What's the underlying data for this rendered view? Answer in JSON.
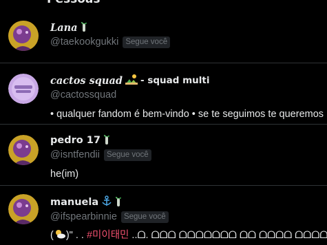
{
  "header": {
    "title": "Pessoas"
  },
  "colors": {
    "background": "#000000",
    "divider": "#2f3336",
    "primary_text": "#e7e9ea",
    "secondary_text": "#71767b",
    "badge_bg": "#202327"
  },
  "users": [
    {
      "name": "Lana",
      "name_icons": [
        "seedling-icon"
      ],
      "handle": "@taekookgukki",
      "follows_you": "Segue você",
      "bio": ""
    },
    {
      "name": "cactos squad",
      "name_suffix": " - squad multi",
      "name_icons": [
        "desert-icon"
      ],
      "handle": "@cactossquad",
      "follows_you": "",
      "bio": "• qualquer fandom é bem-vindo • se te seguimos te queremos"
    },
    {
      "name": "pedro 17",
      "name_icons": [
        "seedling-icon"
      ],
      "handle": "@isntfendii",
      "follows_you": "Segue você",
      "bio": "he(im)"
    },
    {
      "name": "manuela",
      "name_icons": [
        "anchor-icon",
        "seedling-icon"
      ],
      "handle": "@ifspearbinnie",
      "follows_you": "Segue você",
      "bio_prefix": "(",
      "bio_suffix": ")\" . . ",
      "bio_hashtag": "#미이태민",
      "bio_rest": " ..ᗝ. ᗝᗝᗝ ᗝᗝᗝᗝᗝᗝᗝ ᗝᗝ ᗝᗝᗝᗝ ᗝᗝᗝᗝᗝᗝ"
    }
  ]
}
